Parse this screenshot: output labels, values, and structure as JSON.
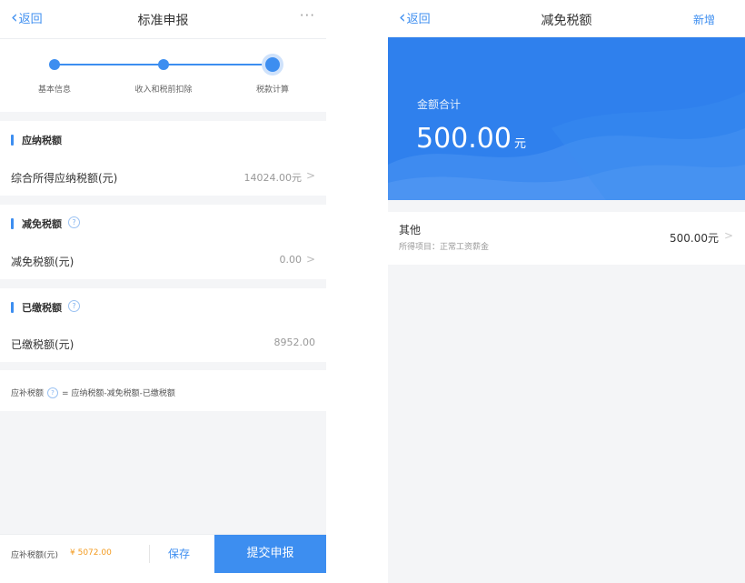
{
  "left": {
    "nav": {
      "back": "返回",
      "title": "标准申报",
      "more": "···"
    },
    "steps": [
      {
        "label": "基本信息"
      },
      {
        "label": "收入和税前扣除"
      },
      {
        "label": "税款计算"
      }
    ],
    "sections": {
      "payable": {
        "title": "应纳税额",
        "row_label": "综合所得应纳税额(元)",
        "row_value": "14024.00元"
      },
      "reduction": {
        "title": "减免税额",
        "row_label": "减免税额(元)",
        "row_value": "0.00"
      },
      "paid": {
        "title": "已缴税额",
        "row_label": "已缴税额(元)",
        "row_value": "8952.00"
      }
    },
    "formula": {
      "left": "应补税额",
      "right": "= 应纳税额-减免税额-已缴税额"
    },
    "bottom": {
      "label": "应补税额(元)",
      "amount": "¥ 5072.00",
      "save": "保存",
      "submit": "提交申报"
    }
  },
  "right": {
    "nav": {
      "back": "返回",
      "title": "减免税额",
      "add": "新增"
    },
    "banner": {
      "title": "金额合计",
      "total": "500.00",
      "unit": "元"
    },
    "item": {
      "name": "其他",
      "sub": "所得项目：正常工资薪金",
      "value": "500.00元"
    }
  },
  "icons": {
    "back": "chevron-left-icon",
    "more": "more-dots-icon",
    "help": "question-circle-icon",
    "row_arrow": "chevron-right-icon"
  },
  "colors": {
    "accent": "#3d8ef0",
    "banner": "#2f80ed",
    "amount": "#f39a1e"
  }
}
